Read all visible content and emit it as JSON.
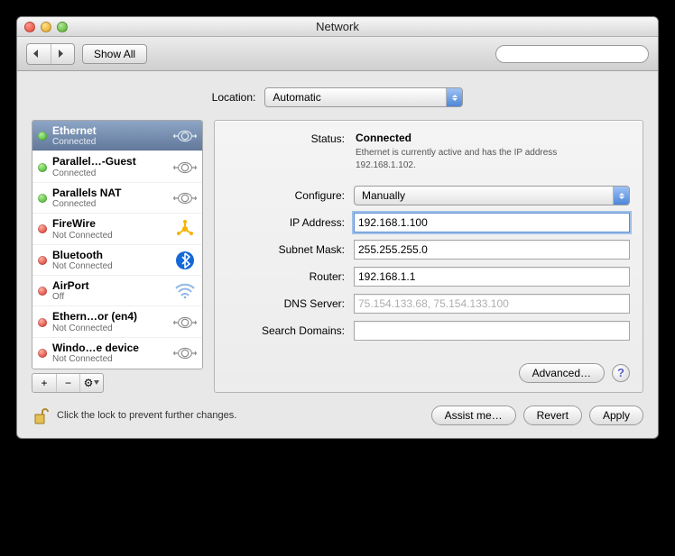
{
  "window": {
    "title": "Network"
  },
  "toolbar": {
    "show_all": "Show All",
    "search_placeholder": ""
  },
  "location": {
    "label": "Location:",
    "value": "Automatic"
  },
  "services": [
    {
      "name": "Ethernet",
      "status": "Connected",
      "dot": "green",
      "icon": "ethernet",
      "selected": true
    },
    {
      "name": "Parallel…-Guest",
      "status": "Connected",
      "dot": "green",
      "icon": "ethernet",
      "selected": false
    },
    {
      "name": "Parallels NAT",
      "status": "Connected",
      "dot": "green",
      "icon": "ethernet",
      "selected": false
    },
    {
      "name": "FireWire",
      "status": "Not Connected",
      "dot": "red",
      "icon": "firewire",
      "selected": false
    },
    {
      "name": "Bluetooth",
      "status": "Not Connected",
      "dot": "red",
      "icon": "bluetooth",
      "selected": false
    },
    {
      "name": "AirPort",
      "status": "Off",
      "dot": "red",
      "icon": "wifi",
      "selected": false
    },
    {
      "name": "Ethern…or (en4)",
      "status": "Not Connected",
      "dot": "red",
      "icon": "ethernet",
      "selected": false
    },
    {
      "name": "Windo…e device",
      "status": "Not Connected",
      "dot": "red",
      "icon": "ethernet",
      "selected": false
    }
  ],
  "sidebar_tools": {
    "add": "+",
    "remove": "−",
    "gear": "⚙"
  },
  "detail": {
    "status_label": "Status:",
    "status_value": "Connected",
    "status_sub": "Ethernet is currently active and has the IP address 192.168.1.102.",
    "fields": {
      "configure": {
        "label": "Configure:",
        "value": "Manually"
      },
      "ip": {
        "label": "IP Address:",
        "value": "192.168.1.100"
      },
      "subnet": {
        "label": "Subnet Mask:",
        "value": "255.255.255.0"
      },
      "router": {
        "label": "Router:",
        "value": "192.168.1.1"
      },
      "dns": {
        "label": "DNS Server:",
        "value": "75.154.133.68, 75.154.133.100"
      },
      "search_domains": {
        "label": "Search Domains:",
        "value": ""
      }
    },
    "advanced": "Advanced…",
    "help": "?"
  },
  "footer": {
    "lock_text": "Click the lock to prevent further changes.",
    "assist": "Assist me…",
    "revert": "Revert",
    "apply": "Apply"
  }
}
